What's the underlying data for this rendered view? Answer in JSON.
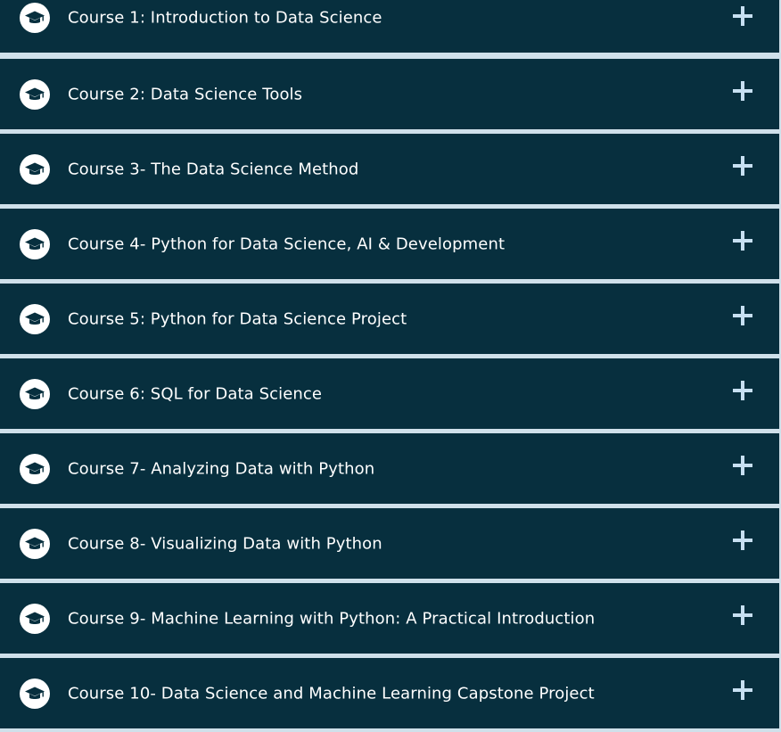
{
  "courses": [
    {
      "title": "Course 1: Introduction to Data Science",
      "icon": "graduation-cap-icon",
      "toggle_icon": "plus-icon"
    },
    {
      "title": "Course 2: Data Science Tools",
      "icon": "graduation-cap-icon",
      "toggle_icon": "plus-icon"
    },
    {
      "title": "Course 3- The Data Science Method",
      "icon": "graduation-cap-icon",
      "toggle_icon": "plus-icon"
    },
    {
      "title": "Course 4- Python for Data Science, AI & Development",
      "icon": "graduation-cap-icon",
      "toggle_icon": "plus-icon"
    },
    {
      "title": "Course 5: Python for Data Science Project",
      "icon": "graduation-cap-icon",
      "toggle_icon": "plus-icon"
    },
    {
      "title": "Course 6: SQL for Data Science",
      "icon": "graduation-cap-icon",
      "toggle_icon": "plus-icon"
    },
    {
      "title": "Course 7- Analyzing Data with Python",
      "icon": "graduation-cap-icon",
      "toggle_icon": "plus-icon"
    },
    {
      "title": "Course 8- Visualizing Data with Python",
      "icon": "graduation-cap-icon",
      "toggle_icon": "plus-icon"
    },
    {
      "title": "Course 9- Machine Learning with Python: A Practical Introduction",
      "icon": "graduation-cap-icon",
      "toggle_icon": "plus-icon"
    },
    {
      "title": "Course 10- Data Science and Machine Learning Capstone Project",
      "icon": "graduation-cap-icon",
      "toggle_icon": "plus-icon"
    }
  ],
  "colors": {
    "header_background": "#072f3e",
    "divider": "#cfe0ea",
    "title_text": "#ffffff",
    "plus_icon": "#c7e0f2",
    "cap_icon_circle": "#ffffff"
  }
}
